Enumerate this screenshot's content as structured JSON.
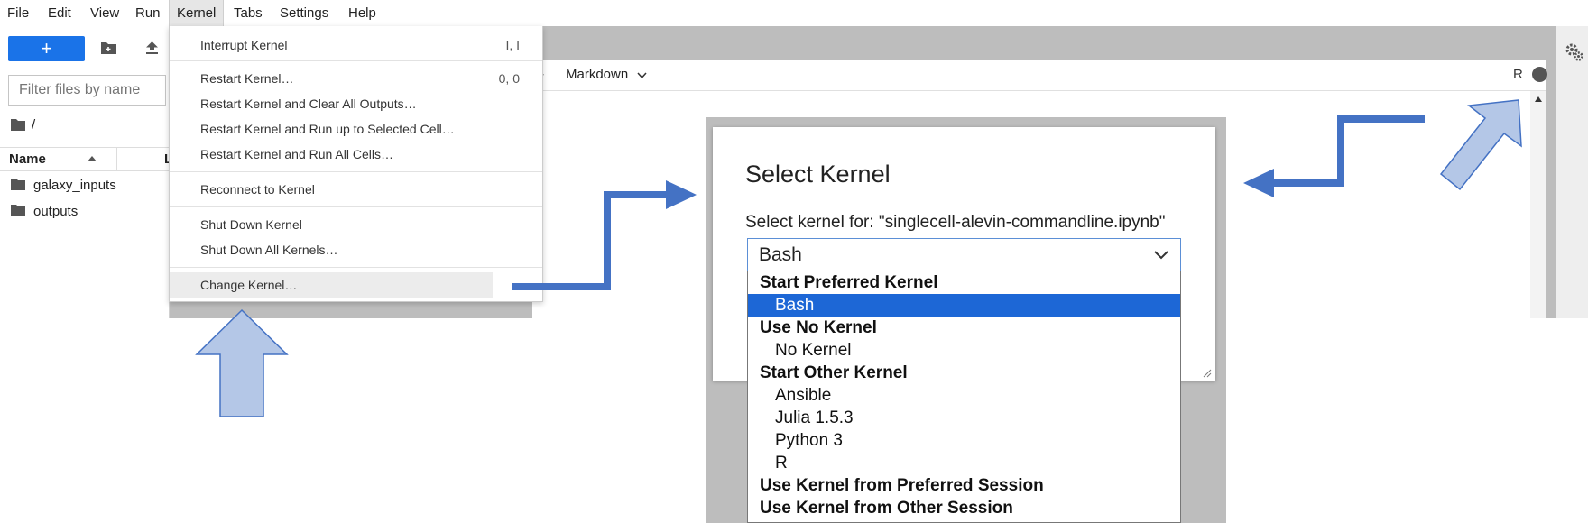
{
  "menubar": {
    "items": [
      "File",
      "Edit",
      "View",
      "Run",
      "Kernel",
      "Tabs",
      "Settings",
      "Help"
    ]
  },
  "sidebar": {
    "new_label": "+",
    "filter_placeholder": "Filter files by name",
    "path": "/",
    "col_name": "Name",
    "col_modified": "L",
    "files": [
      "galaxy_inputs",
      "outputs"
    ]
  },
  "kernel_menu": {
    "items": [
      {
        "label": "Interrupt Kernel",
        "shortcut": "I, I"
      },
      {
        "label": "Restart Kernel…",
        "shortcut": "0, 0"
      },
      {
        "label": "Restart Kernel and Clear All Outputs…",
        "shortcut": ""
      },
      {
        "label": "Restart Kernel and Run up to Selected Cell…",
        "shortcut": ""
      },
      {
        "label": "Restart Kernel and Run All Cells…",
        "shortcut": ""
      },
      {
        "label": "Reconnect to Kernel",
        "shortcut": ""
      },
      {
        "label": "Shut Down Kernel",
        "shortcut": ""
      },
      {
        "label": "Shut Down All Kernels…",
        "shortcut": ""
      },
      {
        "label": "Change Kernel…",
        "shortcut": ""
      }
    ]
  },
  "notebook": {
    "cell_type": "Markdown",
    "kernel_name": "R"
  },
  "dialog": {
    "title": "Select Kernel",
    "label": "Select kernel for: \"singlecell-alevin-commandline.ipynb\"",
    "selected": "Bash",
    "options": [
      {
        "text": "Start Preferred Kernel",
        "kind": "group"
      },
      {
        "text": "Bash",
        "kind": "option",
        "selected": true
      },
      {
        "text": "Use No Kernel",
        "kind": "group"
      },
      {
        "text": "No Kernel",
        "kind": "option"
      },
      {
        "text": "Start Other Kernel",
        "kind": "group"
      },
      {
        "text": "Ansible",
        "kind": "option"
      },
      {
        "text": "Julia 1.5.3",
        "kind": "option"
      },
      {
        "text": "Python 3",
        "kind": "option"
      },
      {
        "text": "R",
        "kind": "option"
      },
      {
        "text": "Use Kernel from Preferred Session",
        "kind": "group"
      },
      {
        "text": "Use Kernel from Other Session",
        "kind": "group"
      }
    ]
  },
  "colors": {
    "accent": "#1a73e8",
    "selection": "#1d67d6",
    "arrow_fill": "#b4c7e7",
    "arrow_stroke": "#4472c4"
  }
}
